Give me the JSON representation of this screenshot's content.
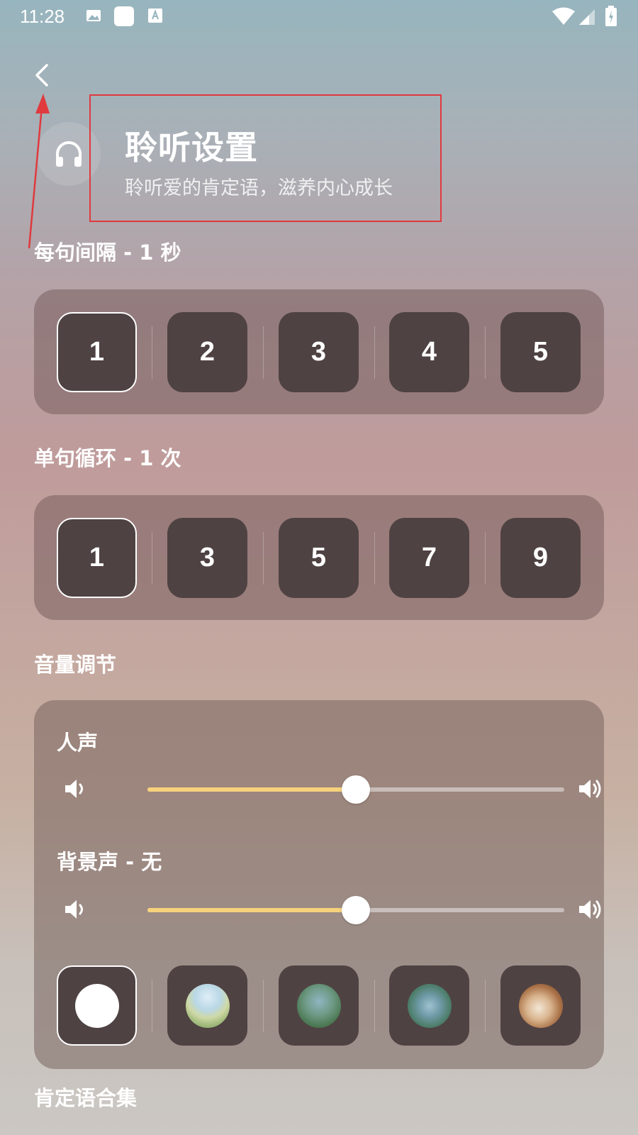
{
  "status_bar": {
    "time": "11:28"
  },
  "header": {
    "title": "聆听设置",
    "subtitle": "聆听爱的肯定语，滋养内心成长"
  },
  "interval": {
    "label": "每句间隔 - 1 秒",
    "options": [
      "1",
      "2",
      "3",
      "4",
      "5"
    ],
    "selected": "1"
  },
  "loop": {
    "label": "单句循环 - 1 次",
    "options": [
      "1",
      "3",
      "5",
      "7",
      "9"
    ],
    "selected": "1"
  },
  "volume": {
    "label": "音量调节",
    "voice": {
      "label": "人声",
      "level": 0.5
    },
    "background": {
      "label": "背景声 - 无",
      "level": 0.5,
      "options": [
        "none",
        "meadow",
        "birds-forest",
        "rainy-alley",
        "cafe"
      ],
      "selected": "none"
    }
  },
  "collection": {
    "label": "肯定语合集"
  },
  "colors": {
    "slider_fill": "#f7d27c",
    "option_bg": "#4f4242",
    "annotation": "#e03a3e"
  }
}
